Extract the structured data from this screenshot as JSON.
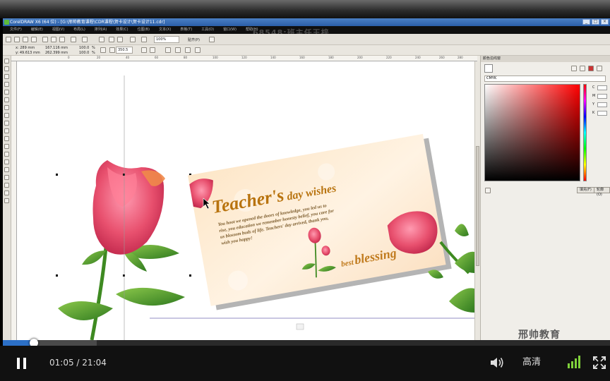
{
  "app": {
    "title": "CorelDRAW X6 (64 位) - [G:\\邢帅教育课程\\CDR课程\\贺卡设计\\贺卡设计11.cdr]",
    "menu": [
      "文件(F)",
      "编辑(E)",
      "视图(V)",
      "布局(L)",
      "排列(A)",
      "效果(C)",
      "位图(B)",
      "文本(X)",
      "表格(T)",
      "工具(O)",
      "窗口(W)",
      "帮助(H)"
    ],
    "window_controls": [
      "_",
      "□",
      "×"
    ]
  },
  "overlay": {
    "watermark": "68548:班主任王梓",
    "logo": "邢帅教育"
  },
  "toolbar": {
    "zoom": "100%",
    "snap": "贴齐(P)",
    "x": "x: 289 mm",
    "y": "y: 49.613 mm",
    "width": "167.116 mm",
    "height": "262.399 mm",
    "scale_x": "100.0",
    "scale_y": "100.0",
    "scale_unit": "%",
    "rotation": "350.5"
  },
  "ruler": {
    "marks": [
      "0",
      "20",
      "40",
      "60",
      "80",
      "100",
      "120",
      "140",
      "160",
      "180",
      "200",
      "220",
      "240",
      "260",
      "280"
    ]
  },
  "card": {
    "title_main": "Teacher's",
    "title_sub": " day wishes",
    "body_lines": [
      "You hoot we opened the doors of knowledge, you led us to",
      "rise, you education we remember honesty belief, you care for",
      "us blossom buds of life. Teachers' day arrived, thank you,",
      "wish you happy!"
    ],
    "blessing_small": "best",
    "blessing_big": "blessing"
  },
  "docker": {
    "title": "颜色泊坞窗",
    "model": "CMYK",
    "channels": [
      "C",
      "M",
      "Y",
      "K"
    ],
    "fill_button": "填充(F)",
    "outline_button": "轮廓(O)"
  },
  "player": {
    "current_time": "01:05",
    "separator": "/",
    "total_time": "21:04",
    "progress": 0.051,
    "buffered": 0.155,
    "quality": "高清"
  },
  "colors": {
    "accent": "#2c70c7",
    "signal": "#7fd13b",
    "title_gold": "#b8730e",
    "rose": "#e8506e"
  }
}
